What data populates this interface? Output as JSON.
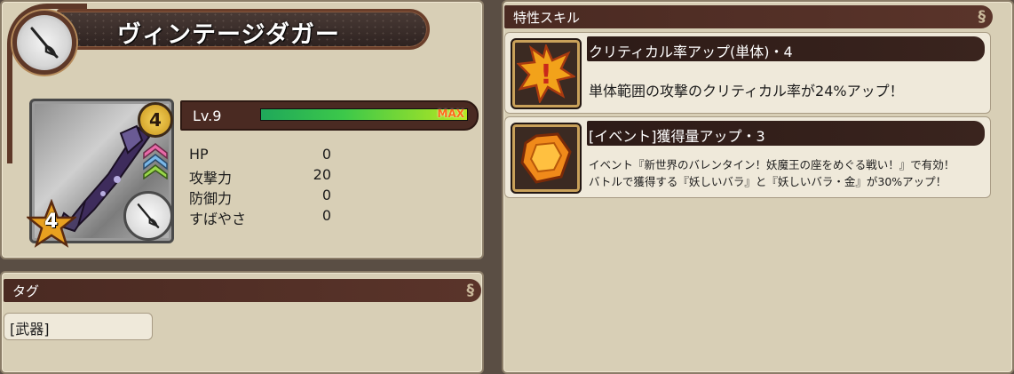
{
  "item": {
    "name": "ヴィンテージダガー",
    "rarity": "4",
    "stars": "4",
    "level_label": "Lv.9",
    "max_label": "MAX",
    "exp_fraction": 1.0
  },
  "stats": [
    {
      "label": "HP",
      "value": "0"
    },
    {
      "label": "攻撃力",
      "value": "20"
    },
    {
      "label": "防御力",
      "value": "0"
    },
    {
      "label": "すばやさ",
      "value": "0"
    }
  ],
  "tags": {
    "header": "タグ",
    "items": [
      "[武器]"
    ]
  },
  "skills": {
    "header": "特性スキル",
    "list": [
      {
        "title": "クリティカル率アップ(単体)・4",
        "description": "単体範囲の攻撃のクリティカル率が24%アップ！",
        "icon": "critical-exclamation-icon"
      },
      {
        "title": "[イベント]獲得量アップ・3",
        "description_lines": [
          "イベント『新世界のバレンタイン！妖魔王の座をめぐる戦い！』で有効！",
          "バトルで獲得する『妖しいバラ』と『妖しいバラ・金』が30%アップ！"
        ],
        "icon": "orange-gem-icon"
      }
    ]
  },
  "colors": {
    "panel": "#d8cfb6",
    "header_bar": "#4a2a22",
    "exp_green": "#3cc84a",
    "max_orange": "#ff6a1a"
  }
}
